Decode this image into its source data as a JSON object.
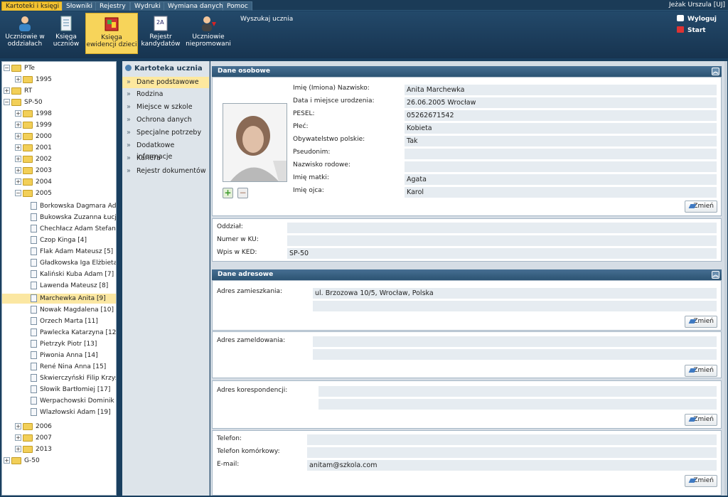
{
  "menu": {
    "tabs": [
      "Kartoteki i księgi",
      "Słowniki",
      "Rejestry",
      "Wydruki",
      "Wymiana danych",
      "Pomoc"
    ],
    "user": "Jeżak Urszula [UJ]"
  },
  "toolbar": {
    "buttons": [
      "Uczniowie w oddziałach",
      "Księga uczniów",
      "Księga ewidencji dzieci",
      "Rejestr kandydatów",
      "Uczniowie niepromowani"
    ],
    "search": "Wyszukaj ucznia",
    "logout": "Wyloguj",
    "start": "Start"
  },
  "tree": {
    "nodes": [
      "PTe",
      "1995",
      "RT",
      "SP-50",
      "1998",
      "1999",
      "2000",
      "2001",
      "2002",
      "2003",
      "2004",
      "2005",
      "Borkowska Dagmara Ada [1",
      "Bukowska Zuzanna Łucja [2",
      "Chechłacz Adam Stefan [3]",
      "Czop Kinga [4]",
      "Flak Adam Mateusz [5]",
      "Gładkowska Iga Elżbieta [6]",
      "Kaliński Kuba Adam [7]",
      "Lawenda Mateusz [8]",
      "Marchewka Anita [9]",
      "Nowak Magdalena [10]",
      "Orzech Marta [11]",
      "Pawlecka Katarzyna [12]",
      "Pietrzyk Piotr [13]",
      "Piwonia Anna [14]",
      "René Nina Anna [15]",
      "Skwierczyński Filip Krzyszto",
      "Słowik Bartłomiej [17]",
      "Werpachowski Dominik Stan",
      "Wlazłowski Adam [19]",
      "2006",
      "2007",
      "2013",
      "G-50"
    ]
  },
  "nav": {
    "title": "Kartoteka ucznia",
    "items": [
      "Dane podstawowe",
      "Rodzina",
      "Miejsce w szkole",
      "Ochrona danych",
      "Specjalne potrzeby",
      "Dodatkowe informacje",
      "Kariera",
      "Rejestr dokumentów"
    ]
  },
  "personal": {
    "title": "Dane osobowe",
    "labels": [
      "Imię (Imiona) Nazwisko:",
      "Data i miejsce urodzenia:",
      "PESEL:",
      "Płeć:",
      "Obywatelstwo polskie:",
      "Pseudonim:",
      "Nazwisko rodowe:",
      "Imię matki:",
      "Imię ojca:"
    ],
    "values": [
      "Anita Marchewka",
      "26.06.2005 Wrocław",
      "05262671542",
      "Kobieta",
      "Tak",
      "",
      "",
      "Agata",
      "Karol"
    ],
    "edit": "Zmień"
  },
  "school": {
    "labels": [
      "Oddział:",
      "Numer w KU:",
      "Wpis w KED:"
    ],
    "values": [
      "",
      "",
      "SP-50"
    ]
  },
  "address": {
    "title": "Dane adresowe",
    "live_label": "Adres zamieszkania:",
    "live_value": "ul. Brzozowa 10/5, Wrocław, Polska",
    "reg_label": "Adres zameldowania:",
    "corr_label": "Adres korespondencji:",
    "edit": "Zmień"
  },
  "contact": {
    "labels": [
      "Telefon:",
      "Telefon komórkowy:",
      "E-mail:"
    ],
    "values": [
      "",
      "",
      "anitam@szkola.com"
    ],
    "edit": "Zmień"
  }
}
